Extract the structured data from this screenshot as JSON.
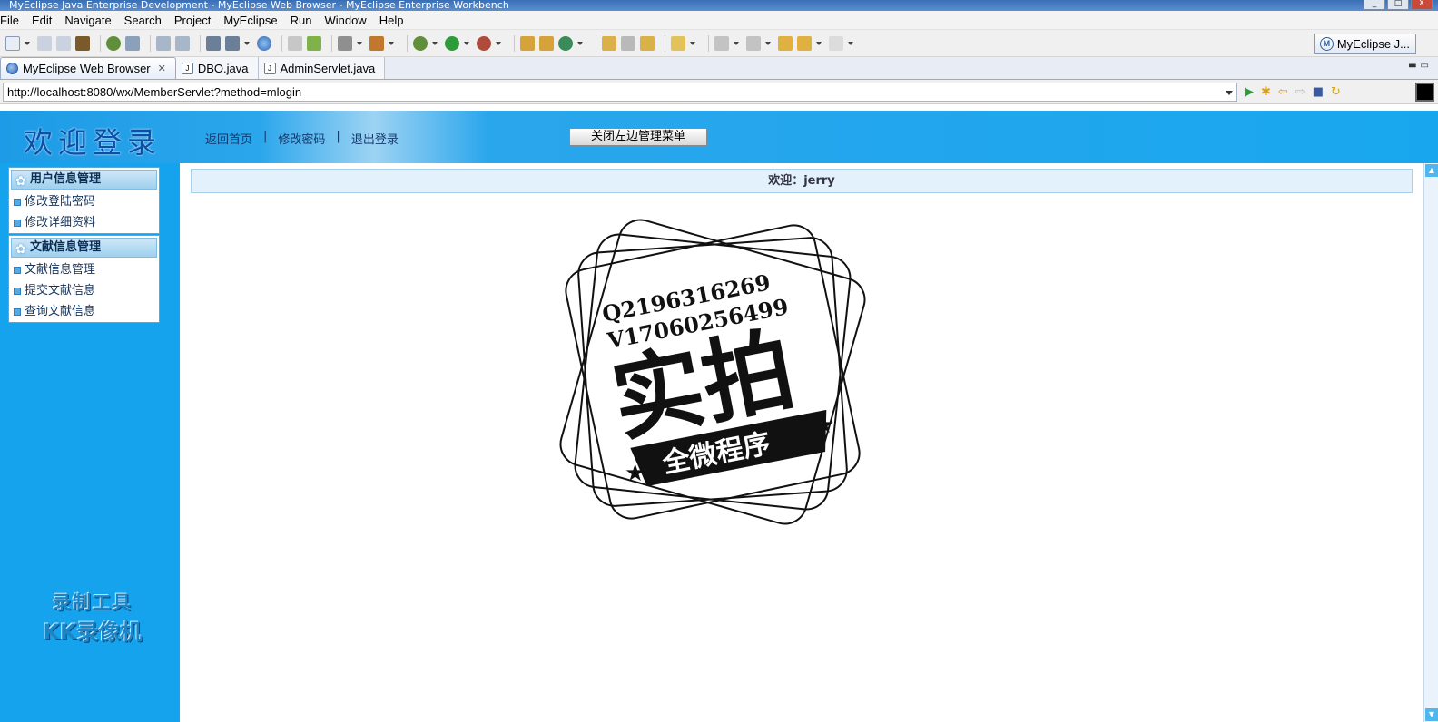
{
  "window": {
    "title": "MyEclipse Java Enterprise Development - MyEclipse Web Browser - MyEclipse Enterprise Workbench",
    "controls": [
      "_",
      "□",
      "X"
    ]
  },
  "menubar": [
    "File",
    "Edit",
    "Navigate",
    "Search",
    "Project",
    "MyEclipse",
    "Run",
    "Window",
    "Help"
  ],
  "perspective": {
    "icon": "M",
    "label": "MyEclipse J..."
  },
  "tabs": [
    {
      "label": "MyEclipse Web Browser",
      "icon": "globe-icon",
      "active": true,
      "close": "✕"
    },
    {
      "label": "DBO.java",
      "icon": "java-file-icon",
      "icon_text": "J",
      "active": false
    },
    {
      "label": "AdminServlet.java",
      "icon": "java-file-icon",
      "icon_text": "J",
      "active": false
    }
  ],
  "url": "http://localhost:8080/wx/MemberServlet?method=mlogin",
  "page": {
    "header_title": "欢迎登录",
    "links": [
      "返回首页",
      "修改密码",
      "退出登录"
    ],
    "link_separator": "|",
    "close_menu_button": "关闭左边管理菜单",
    "welcome_text": "欢迎：jerry"
  },
  "sidebar": {
    "groups": [
      {
        "title": "用户信息管理",
        "items": [
          "修改登陆密码",
          "修改详细资料"
        ]
      },
      {
        "title": "文献信息管理",
        "items": [
          "文献信息管理",
          "提交文献信息",
          "查询文献信息"
        ]
      }
    ]
  },
  "overlay": {
    "kk_line1": "录制工具",
    "kk_line2": "KK录像机",
    "stamp_line1": "Q2196316269",
    "stamp_line2": "V17060256499",
    "stamp_main": "实拍",
    "stamp_banner": "全微程序"
  },
  "colors": {
    "sidebar_bg": "#14a3ec",
    "header_title": "#0b4fa8",
    "welcome_bar": "#e2f1fb"
  }
}
